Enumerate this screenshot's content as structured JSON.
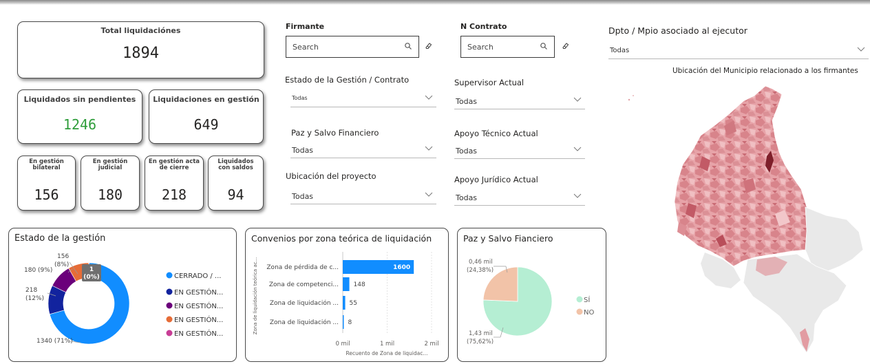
{
  "kpis": {
    "total": {
      "label": "Total liquidaciónes",
      "value": "1894"
    },
    "sin_pendientes": {
      "label": "Liquidados sin pendientes",
      "value": "1246",
      "color": "#2E9D3A"
    },
    "en_gestion": {
      "label": "Liquidaciones en gestión",
      "value": "649"
    },
    "bilateral": {
      "label": "En gestión bilateral",
      "value": "156"
    },
    "judicial": {
      "label": "En gestión judicial",
      "value": "180"
    },
    "acta": {
      "label": "En gestión acta de cierre",
      "value": "218"
    },
    "saldos": {
      "label": "Liquidados con saldos",
      "value": "94"
    }
  },
  "filters": {
    "firmante": {
      "label": "Firmante",
      "placeholder": "Search"
    },
    "contrato": {
      "label": "N Contrato",
      "placeholder": "Search"
    },
    "dpto": {
      "label": "Dpto / Mpio asociado al ejecutor",
      "value": "Todas"
    },
    "estado": {
      "label": "Estado de la Gestión / Contrato",
      "value": "Todas"
    },
    "supervisor": {
      "label": "Supervisor Actual",
      "value": "Todas"
    },
    "paz_salvo": {
      "label": "Paz y Salvo Financiero",
      "value": "Todas"
    },
    "apoyo_tecnico": {
      "label": "Apoyo Técnico Actual",
      "value": "Todas"
    },
    "ubicacion": {
      "label": "Ubicación del proyecto",
      "value": "Todas"
    },
    "apoyo_juridico": {
      "label": "Apoyo Jurídico Actual",
      "value": "Todas"
    }
  },
  "map": {
    "title": "Ubicación del Municipio relacionado a los firmantes"
  },
  "chart_data": [
    {
      "type": "pie",
      "title": "Estado de la gestión",
      "donut": true,
      "slices": [
        {
          "legend": "CERRADO / ...",
          "value": 1340,
          "label": "1340 (71%)",
          "color": "#118DFF"
        },
        {
          "legend": "EN GESTIÓN...",
          "value": 218,
          "label": "218 (12%)",
          "color": "#12239E"
        },
        {
          "legend": "EN GESTIÓN...",
          "value": 180,
          "label": "180 (9%)",
          "color": "#6B007B"
        },
        {
          "legend": "EN GESTIÓN...",
          "value": 156,
          "label": "156 (8%)",
          "color": "#E66C37"
        },
        {
          "legend": "EN GESTIÓN...",
          "value": 1,
          "label": "1 (0%)",
          "color": "#D64550"
        }
      ],
      "extra_legend_color": "#C83D95"
    },
    {
      "type": "bar",
      "orientation": "horizontal",
      "title": "Convenios por zona teórica de liquidación",
      "categories": [
        "Zona de pérdida de c...",
        "Zona de competenci...",
        "Zona de liquidación ...",
        "Zona de liquidación ..."
      ],
      "values": [
        1600,
        148,
        55,
        8
      ],
      "value_labels": [
        "1600",
        "148",
        "55",
        "8"
      ],
      "xlabel": "Recuento de Zona de liquidac...",
      "ylabel": "Zona de liquidación teórica ac...",
      "xlim": [
        0,
        2000
      ],
      "xticks": [
        "0 mil",
        "1 mil",
        "2 mil"
      ],
      "color": "#118DFF"
    },
    {
      "type": "pie",
      "title": "Paz y Salvo Fianciero",
      "slices": [
        {
          "legend": "SÍ",
          "value": 1430,
          "label_value": "1,43 mil",
          "label_pct": "(75,62%)",
          "color": "#B5EED3"
        },
        {
          "legend": "NO",
          "value": 460,
          "label_value": "0,46 mil",
          "label_pct": "(24,38%)",
          "color": "#F2C3A8"
        }
      ]
    }
  ]
}
